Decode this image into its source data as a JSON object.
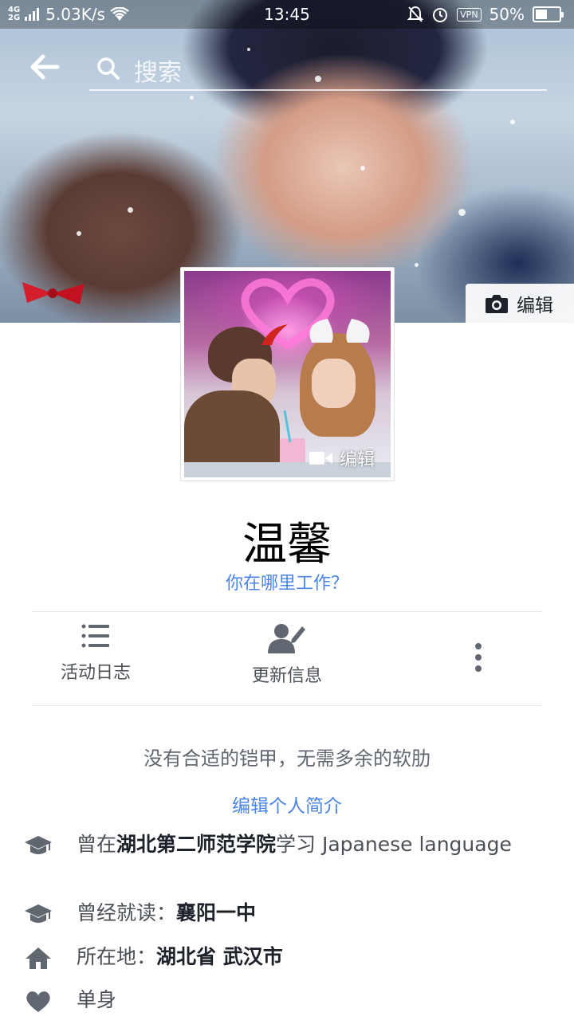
{
  "status_bar": {
    "network_top": "4G",
    "network_bottom": "2G",
    "speed": "5.03K/s",
    "time": "13:45",
    "vpn": "VPN",
    "battery": "50%",
    "battery_level": 0.5
  },
  "header": {
    "search_placeholder": "搜索"
  },
  "cover": {
    "edit_label": "编辑"
  },
  "avatar": {
    "edit_label": "编辑"
  },
  "profile": {
    "name": "温馨",
    "work_prompt": "你在哪里工作？"
  },
  "actions": {
    "activity_log": "活动日志",
    "update_info": "更新信息"
  },
  "bio": {
    "motto": "没有合适的铠甲，无需多余的软肋",
    "edit_label": "编辑个人简介"
  },
  "info": {
    "university_prefix": "曾在",
    "university_name": "湖北第二师范学院",
    "university_suffix": "学习 Japanese language",
    "school_prefix": "曾经就读：",
    "school_name": "襄阳一中",
    "location_prefix": "所在地：",
    "location_name": "湖北省 武汉市",
    "relationship": "单身"
  },
  "colors": {
    "accent_link": "#4a86e8",
    "icon_gray": "#606770",
    "text_dark": "#1d2129"
  }
}
